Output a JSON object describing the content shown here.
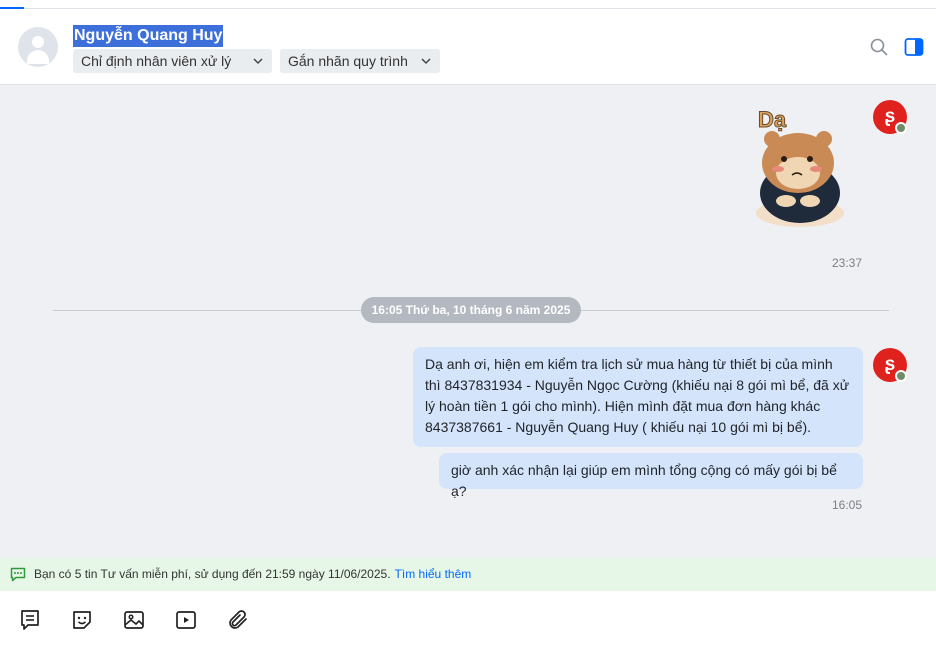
{
  "contact": {
    "name": "Nguyễn Quang Huy",
    "assign_label": "Chỉ định nhân viên xử lý",
    "tag_label": "Gắn nhãn quy trình"
  },
  "header_icons": [
    "search-icon",
    "toggle-panel-icon"
  ],
  "messages": {
    "sticker": {
      "text": "Dạ",
      "time": "23:37"
    },
    "date_separator": "16:05 Thứ ba, 10 tháng 6 năm 2025",
    "bubble1": "Dạ anh ơi, hiện em kiểm tra lịch sử mua hàng từ thiết bị của mình thì 8437831934 - Nguyễn Ngọc Cường (khiếu nại 8 gói mì bể, đã xử lý hoàn tiền 1 gói cho mình). Hiện mình đặt mua đơn hàng khác 8437387661 - Nguyễn Quang Huy ( khiếu nại 10 gói mì bị bể).",
    "bubble2": "giờ anh xác nhận lại giúp em mình tổng cộng có mấy gói bị bể ạ?",
    "time2": "16:05"
  },
  "notice": {
    "text": "Bạn có 5 tin Tư vấn miễn phí, sử dụng đến 21:59 ngày 11/06/2025.",
    "link": "Tìm hiểu thêm"
  },
  "toolbar": [
    "quick-message-icon",
    "sticker-icon",
    "image-icon",
    "video-icon",
    "attachment-icon"
  ],
  "colors": {
    "accent": "#0068ff",
    "bubble": "#d4e4fb",
    "chat_bg": "#eef0f3",
    "notice_bg": "#e7f7e7",
    "brand_red": "#e0221f"
  }
}
